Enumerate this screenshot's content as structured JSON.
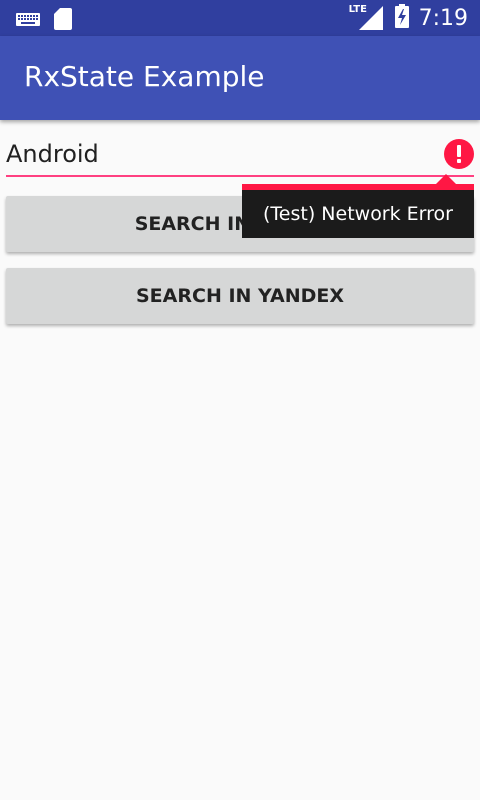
{
  "status_bar": {
    "time": "7:19",
    "network_label": "LTE",
    "icons": [
      "keyboard-icon",
      "sd-card-icon",
      "signal-icon",
      "battery-icon"
    ]
  },
  "app_bar": {
    "title": "RxState Example",
    "color": "#3F51B5"
  },
  "search": {
    "value": "Android",
    "error_text": "(Test) Network Error",
    "accent_color": "#FF4081",
    "error_color": "#FF1744"
  },
  "buttons": {
    "google_label": "SEARCH IN GOOGLE",
    "yandex_label": "SEARCH IN YANDEX"
  }
}
